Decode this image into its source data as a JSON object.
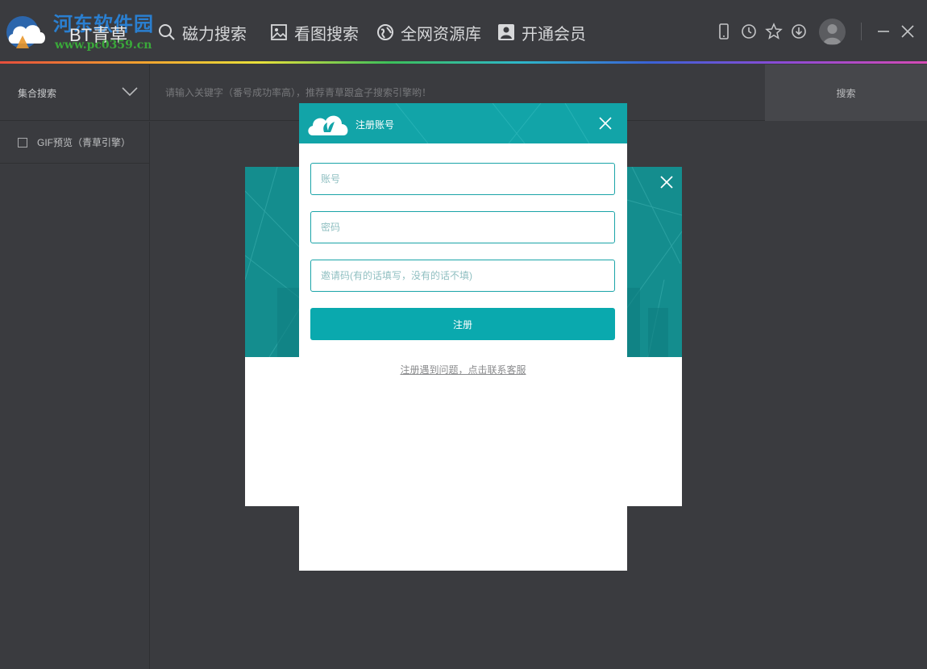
{
  "app": {
    "brand": "BT青草",
    "watermark_cn": "河东软件园",
    "watermark_url": "www.pc0359.cn"
  },
  "nav": [
    {
      "label": "磁力搜索",
      "icon": "search-icon"
    },
    {
      "label": "看图搜索",
      "icon": "image-icon"
    },
    {
      "label": "全网资源库",
      "icon": "globe-icon"
    },
    {
      "label": "开通会员",
      "icon": "member-icon"
    }
  ],
  "toolbar_icons": [
    "phone-icon",
    "history-icon",
    "star-icon",
    "download-icon"
  ],
  "search": {
    "engine": "集合搜索",
    "placeholder": "请输入关键字（番号成功率高），推荐青草跟盒子搜索引擎哟！",
    "button": "搜索"
  },
  "sidebar": {
    "gif_preview": "GIF预览（青草引擎）"
  },
  "register": {
    "title": "注册账号",
    "account_placeholder": "账号",
    "password_placeholder": "密码",
    "invite_placeholder": "邀请码(有的话填写，没有的话不填)",
    "submit": "注册",
    "help": "注册遇到问题，点击联系客服"
  },
  "colors": {
    "accent": "#0aa9ae",
    "background": "#3a3b3f"
  }
}
